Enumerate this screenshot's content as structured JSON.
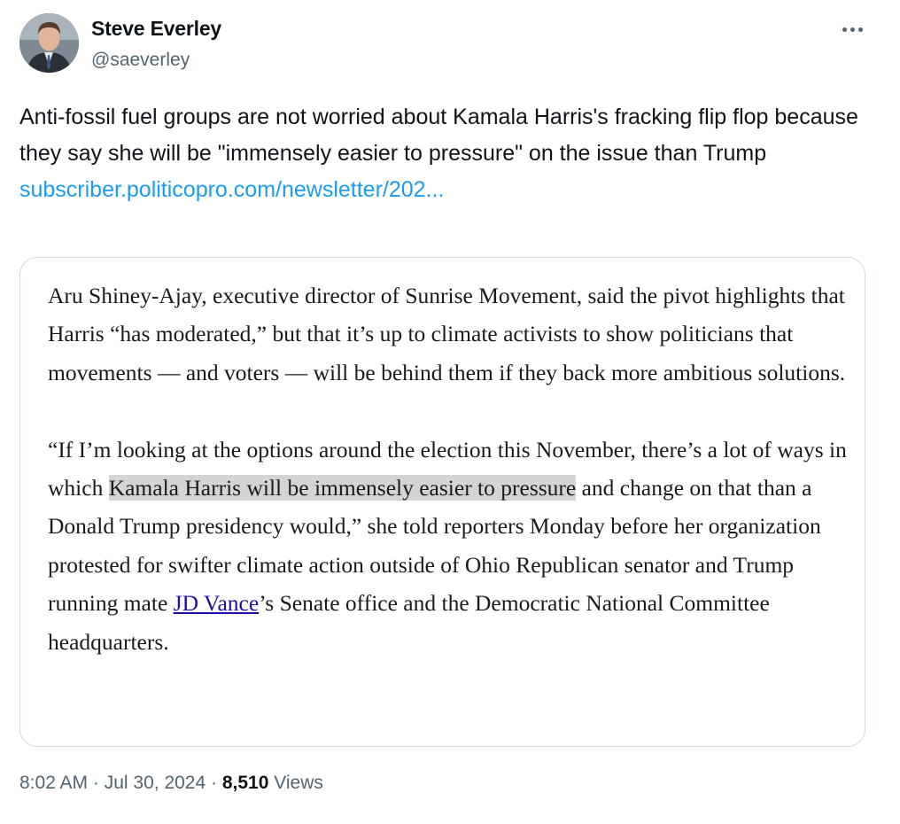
{
  "author": {
    "name": "Steve Everley",
    "handle": "@saeverley",
    "avatar_icon": "profile-photo"
  },
  "more_icon": "more-horizontal-icon",
  "tweet": {
    "text": "Anti-fossil fuel groups are not worried about Kamala Harris's fracking flip flop because they say she will be \"immensely easier to pressure\" on the issue than Trump",
    "link": "subscriber.politicopro.com/newsletter/202..."
  },
  "quote": {
    "para1": "Aru Shiney-Ajay, executive director of Sunrise Movement, said the pivot highlights that Harris “has moderated,” but that it’s up to climate activists to show politicians that movements — and voters — will be behind them if they back more ambitious solutions.",
    "para2_before": "“If I’m looking at the options around the election this November, there’s a lot of ways in which ",
    "para2_highlight": "Kamala Harris will be immensely easier to pressure",
    "para2_middle": " and change on that than a Donald Trump presidency would,” she told reporters Monday before her organization protested for swifter climate action outside of Ohio Republican senator and Trump running mate ",
    "para2_link": "JD Vance",
    "para2_after": "’s Senate office and the Democratic National Committee headquarters."
  },
  "meta": {
    "time": "8:02 AM",
    "separator": " · ",
    "date": "Jul 30, 2024",
    "views_count": "8,510",
    "views_label": " Views"
  },
  "colors": {
    "link_blue": "#1d9bf0",
    "secondary_text": "#536471",
    "card_border": "#cfd9de",
    "highlight": "#d4d4d4",
    "article_link": "#1a0dab"
  }
}
